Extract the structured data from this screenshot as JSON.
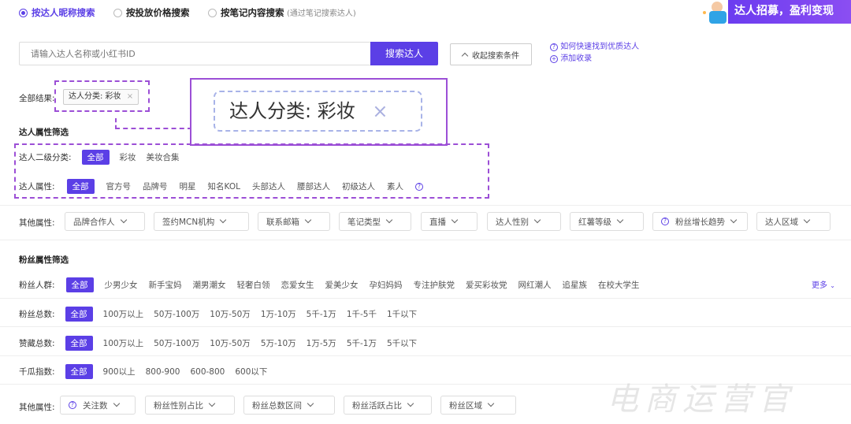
{
  "search_tabs": [
    {
      "label": "按达人昵称搜索",
      "selected": true
    },
    {
      "label": "按投放价格搜索",
      "selected": false
    },
    {
      "label": "按笔记内容搜索",
      "selected": false
    }
  ],
  "search_tab_hint": "(通过笔记搜索达人)",
  "banner": {
    "text": "达人招募，盈利变现"
  },
  "search": {
    "placeholder": "请输入达人名称或小红书ID",
    "button": "搜索达人",
    "collapse": "收起搜索条件"
  },
  "help_links": {
    "find": "如何快速找到优质达人",
    "add": "添加收录"
  },
  "all_results": {
    "label": "全部结果:",
    "tag": "达人分类: 彩妆",
    "tag_close": "×"
  },
  "zoom_callout": {
    "text": "达人分类: 彩妆",
    "close": "×"
  },
  "influencer_section": {
    "title": "达人属性筛选"
  },
  "subcategory": {
    "label": "达人二级分类:",
    "selected": "全部",
    "options": [
      "彩妆",
      "美妆合集"
    ]
  },
  "attributes": {
    "label": "达人属性:",
    "selected": "全部",
    "options": [
      "官方号",
      "品牌号",
      "明星",
      "知名KOL",
      "头部达人",
      "腰部达人",
      "初级达人",
      "素人"
    ]
  },
  "other_attrs": {
    "label": "其他属性:",
    "dropdowns": [
      "品牌合作人",
      "签约MCN机构",
      "联系邮箱",
      "笔记类型",
      "直播",
      "达人性别",
      "红薯等级",
      "粉丝增长趋势",
      "达人区域"
    ]
  },
  "fan_section": {
    "title": "粉丝属性筛选"
  },
  "fan_groups": {
    "label": "粉丝人群:",
    "selected": "全部",
    "options": [
      "少男少女",
      "新手宝妈",
      "潮男潮女",
      "轻奢白领",
      "恋爱女生",
      "爱美少女",
      "孕妇妈妈",
      "专注护肤党",
      "爱买彩妆党",
      "网红潮人",
      "追星族",
      "在校大学生"
    ],
    "more": "更多"
  },
  "fan_total": {
    "label": "粉丝总数:",
    "selected": "全部",
    "options": [
      "100万以上",
      "50万-100万",
      "10万-50万",
      "1万-10万",
      "5千-1万",
      "1千-5千",
      "1千以下"
    ]
  },
  "likes_total": {
    "label": "赞藏总数:",
    "selected": "全部",
    "options": [
      "100万以上",
      "50万-100万",
      "10万-50万",
      "5万-10万",
      "1万-5万",
      "5千-1万",
      "5千以下"
    ]
  },
  "qiangua_index": {
    "label": "千瓜指数:",
    "selected": "全部",
    "options": [
      "900以上",
      "800-900",
      "600-800",
      "600以下"
    ]
  },
  "fan_other_attrs": {
    "label": "其他属性:",
    "dropdowns": [
      "关注数",
      "粉丝性别占比",
      "粉丝总数区间",
      "粉丝活跃占比",
      "粉丝区域"
    ]
  },
  "watermark": "电商运营官",
  "colors": {
    "accent": "#5b3fe6",
    "callout_border": "#9c4fd6"
  }
}
